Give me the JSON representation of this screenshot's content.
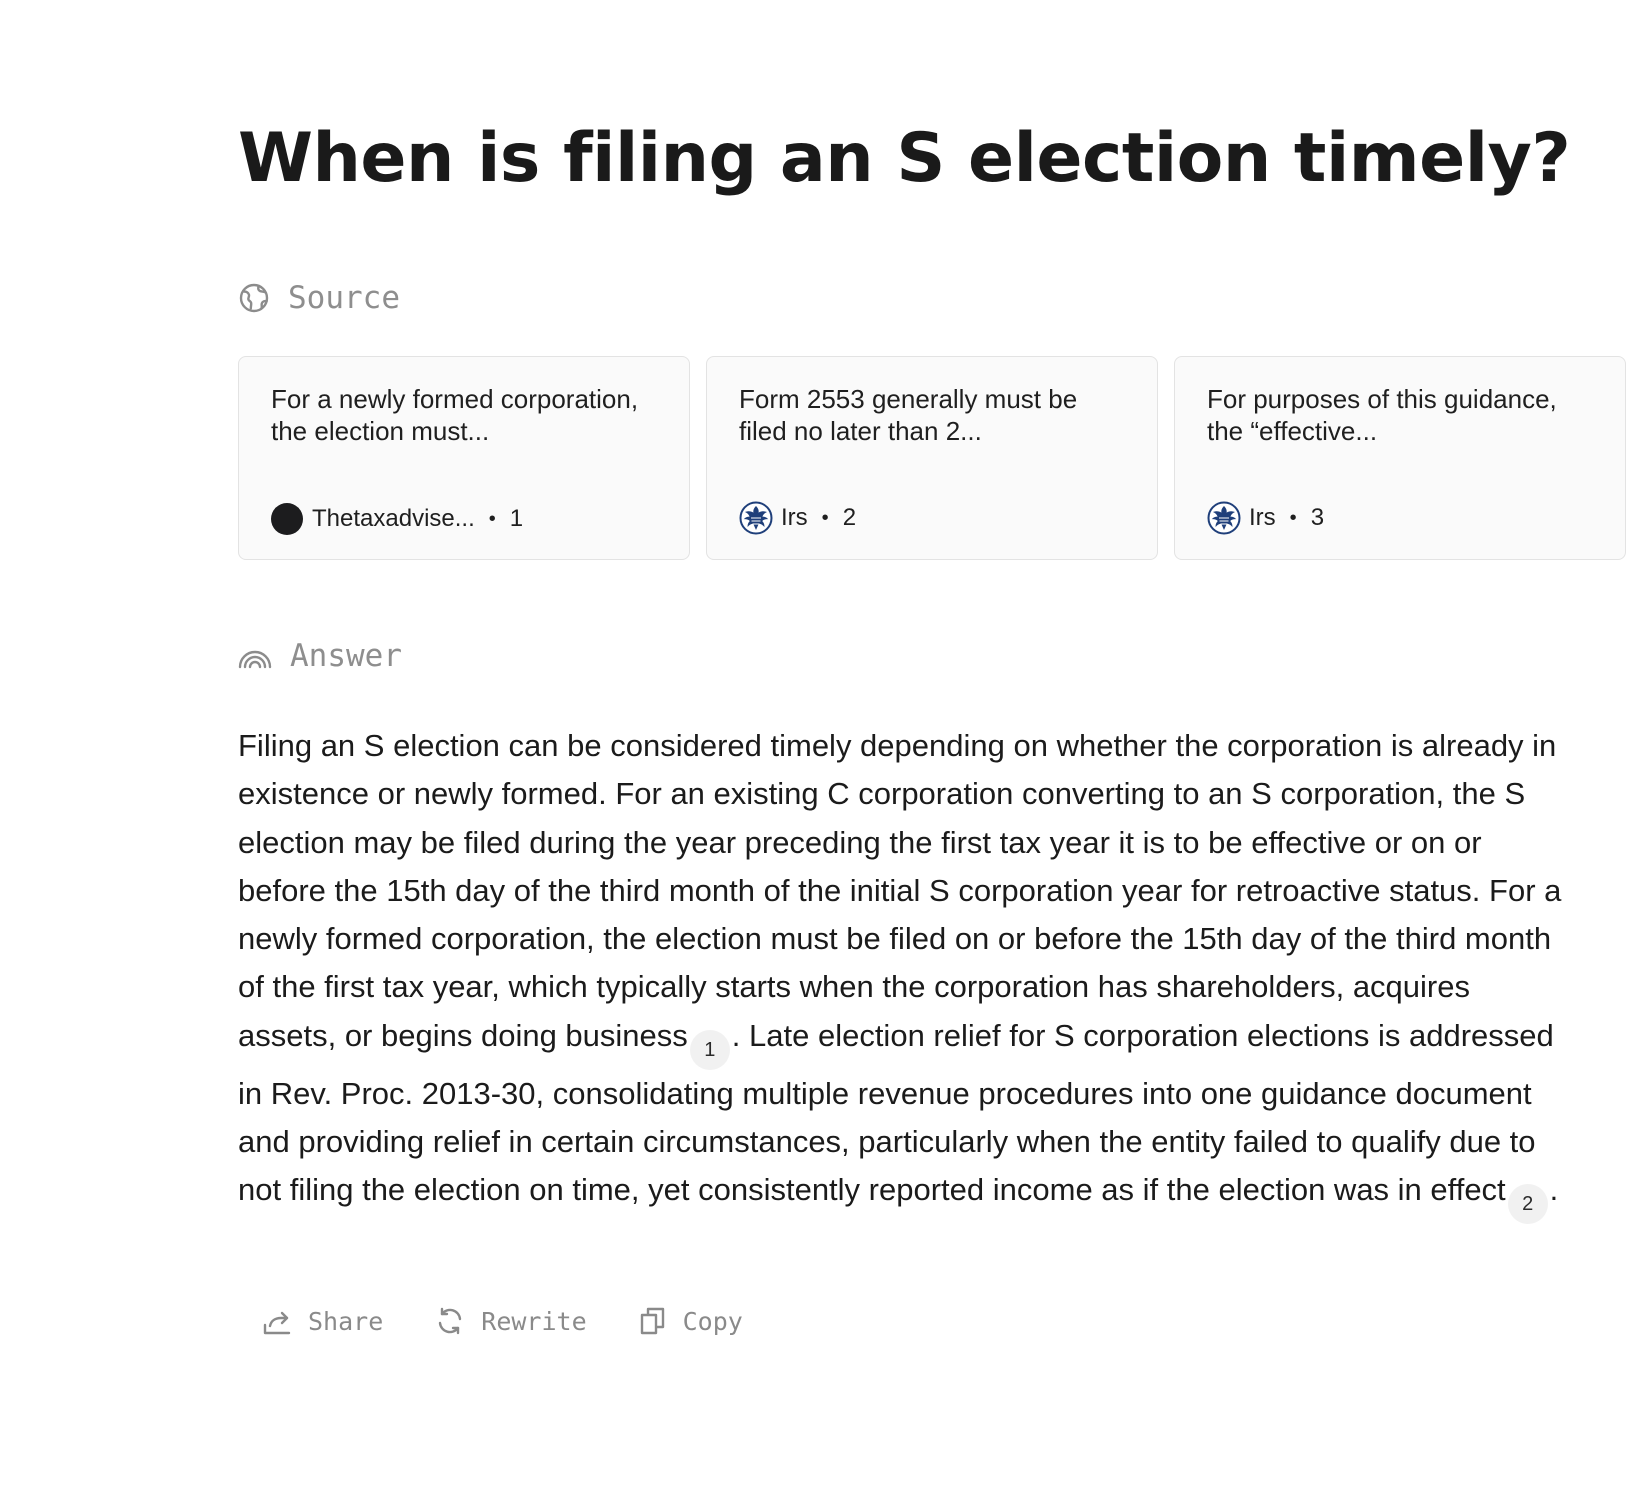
{
  "question": {
    "title": "When is filing an S election timely?"
  },
  "sources": {
    "heading": "Source",
    "cards": [
      {
        "snippet": "For a newly formed corporation, the election must...",
        "site": "Thetaxadvise...",
        "index": "1",
        "favicon": "dark-circle-icon"
      },
      {
        "snippet": "Form 2553 generally must be filed no later than 2...",
        "site": "Irs",
        "index": "2",
        "favicon": "irs-eagle-icon"
      },
      {
        "snippet": "For purposes of this guidance, the “effective...",
        "site": "Irs",
        "index": "3",
        "favicon": "irs-eagle-icon"
      }
    ]
  },
  "answer": {
    "heading": "Answer",
    "part1": "Filing an S election can be considered timely depending on whether the corporation is already in existence or newly formed. For an existing C corporation converting to an S corporation, the S election may be filed during the year preceding the first tax year it is to be effective or on or before the 15th day of the third month of the initial S corporation year for retroactive status. For a newly formed corporation, the election must be filed on or before the 15th day of the third month of the first tax year, which typically starts when the corporation has shareholders, acquires assets, or begins doing business",
    "cite1": "1",
    "part2": ". Late election relief for S corporation elections is addressed in Rev. Proc. 2013-30, consolidating multiple revenue procedures into one guidance document and providing relief in certain circumstances, particularly when the entity failed to qualify due to not filing the election on time, yet consistently reported income as if the election was in effect",
    "cite2": "2",
    "part3": "."
  },
  "actions": {
    "share": "Share",
    "rewrite": "Rewrite",
    "copy": "Copy"
  },
  "colors": {
    "text": "#1b1b1b",
    "muted": "#8c8c8c",
    "card_bg": "#fafafa",
    "card_border": "#e3e3e3",
    "cite_bg": "#f1f1f1",
    "irs_blue": "#1f3f7a"
  }
}
